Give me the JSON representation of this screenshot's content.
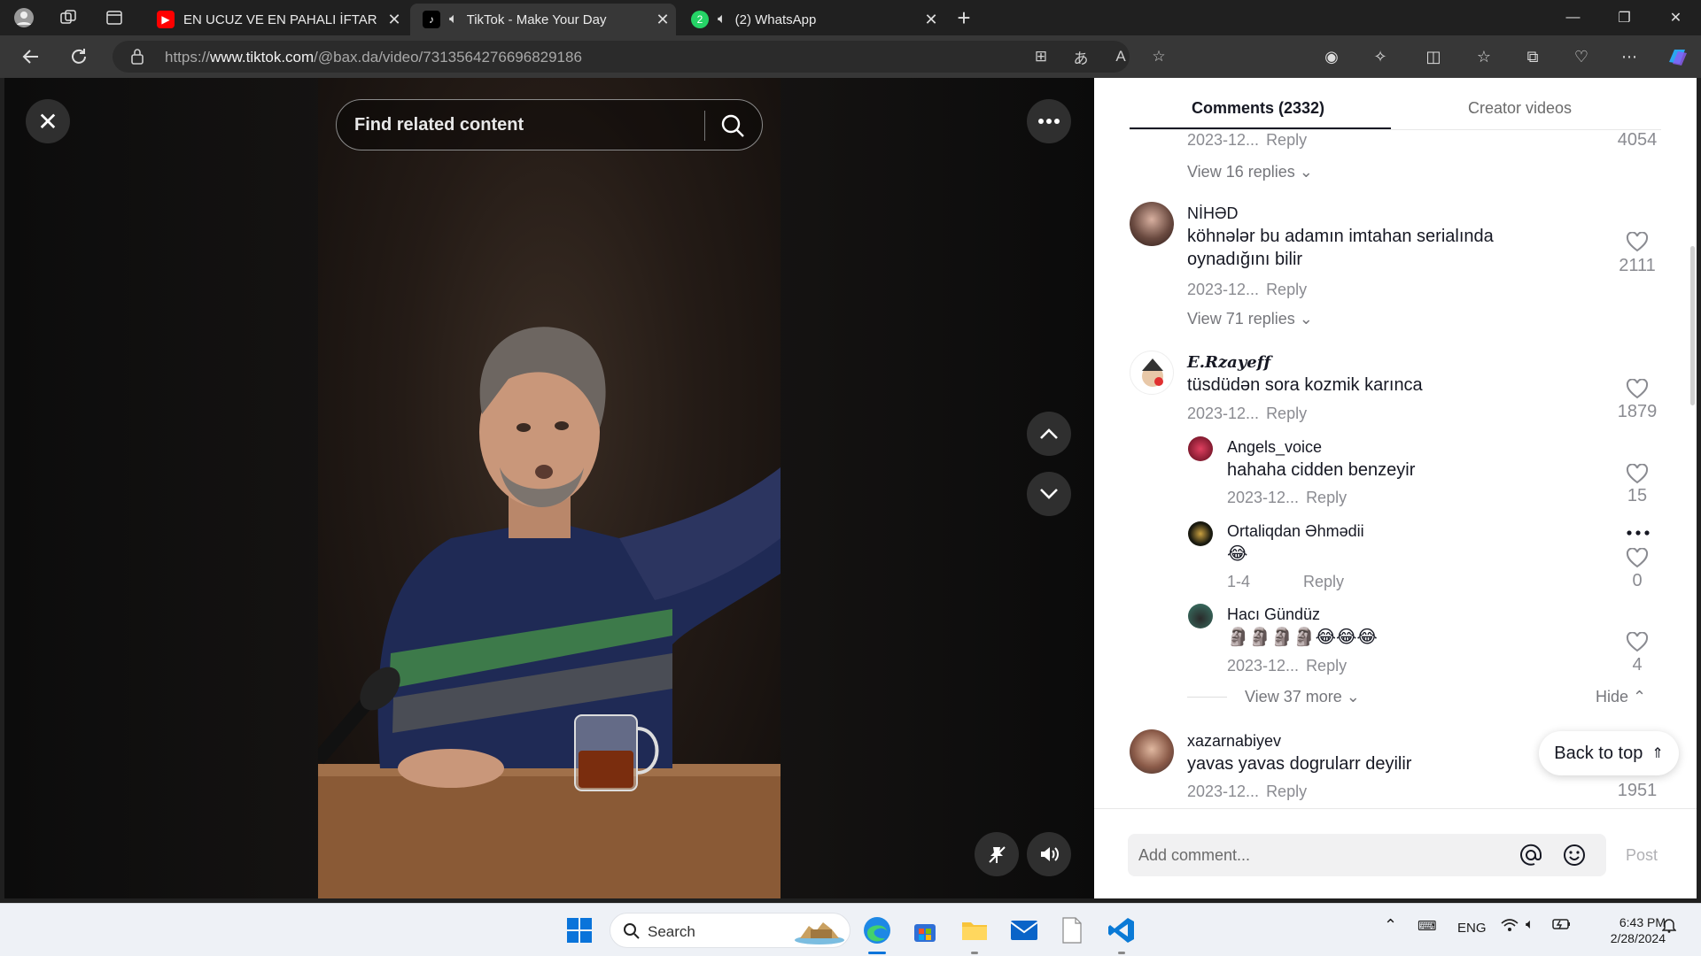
{
  "browser": {
    "tabs": [
      {
        "title": "EN UCUZ VE EN PAHALI İFTAR M",
        "icon": "youtube-icon"
      },
      {
        "title": "TikTok - Make Your Day",
        "icon": "tiktok-icon",
        "active": true
      },
      {
        "title": "(2) WhatsApp",
        "icon": "whatsapp-icon",
        "badge": "2"
      }
    ],
    "url_prefix": "https://",
    "url_host": "www.tiktok.com",
    "url_path": "/@bax.da/video/7313564276696829186"
  },
  "video": {
    "search_placeholder": "Find related content"
  },
  "panel": {
    "tab_comments": "Comments (2332)",
    "tab_creator": "Creator videos",
    "top_meta": {
      "date": "2023-12...",
      "reply": "Reply",
      "likes": "4054",
      "view_replies": "View 16 replies"
    },
    "comments": [
      {
        "user": "NİHƏD",
        "text": "köhnələr bu adamın imtahan serialında oynadığını bilir",
        "date": "2023-12...",
        "reply": "Reply",
        "likes": "2111",
        "view_replies": "View 71 replies"
      },
      {
        "user": "𝑬.𝑹𝒛𝒂𝒚𝒆𝒇𝒇",
        "text": "tüsdüdən sora kozmik karınca",
        "date": "2023-12...",
        "reply": "Reply",
        "likes": "1879"
      }
    ],
    "replies": [
      {
        "user": "Angels_voice",
        "text": "hahaha cidden benzeyir",
        "date": "2023-12...",
        "reply": "Reply",
        "likes": "15"
      },
      {
        "user": "Ortaliqdan Əhmədii",
        "text": "😂",
        "date": "1-4",
        "reply": "Reply",
        "likes": "0"
      },
      {
        "user": "Hacı Gündüz",
        "text": "🗿🗿🗿🗿😂😂😂",
        "date": "2023-12...",
        "reply": "Reply",
        "likes": "4"
      }
    ],
    "view_more": "View 37 more",
    "hide": "Hide",
    "last_comment": {
      "user": "xazarnabiyev",
      "text": "yavas yavas dogrularr deyilir",
      "date": "2023-12...",
      "reply": "Reply",
      "likes": "1951"
    },
    "back_to_top": "Back to top",
    "composer_placeholder": "Add comment...",
    "post": "Post"
  },
  "taskbar": {
    "search_placeholder": "Search",
    "lang": "ENG",
    "time": "6:43 PM",
    "date": "2/28/2024"
  }
}
